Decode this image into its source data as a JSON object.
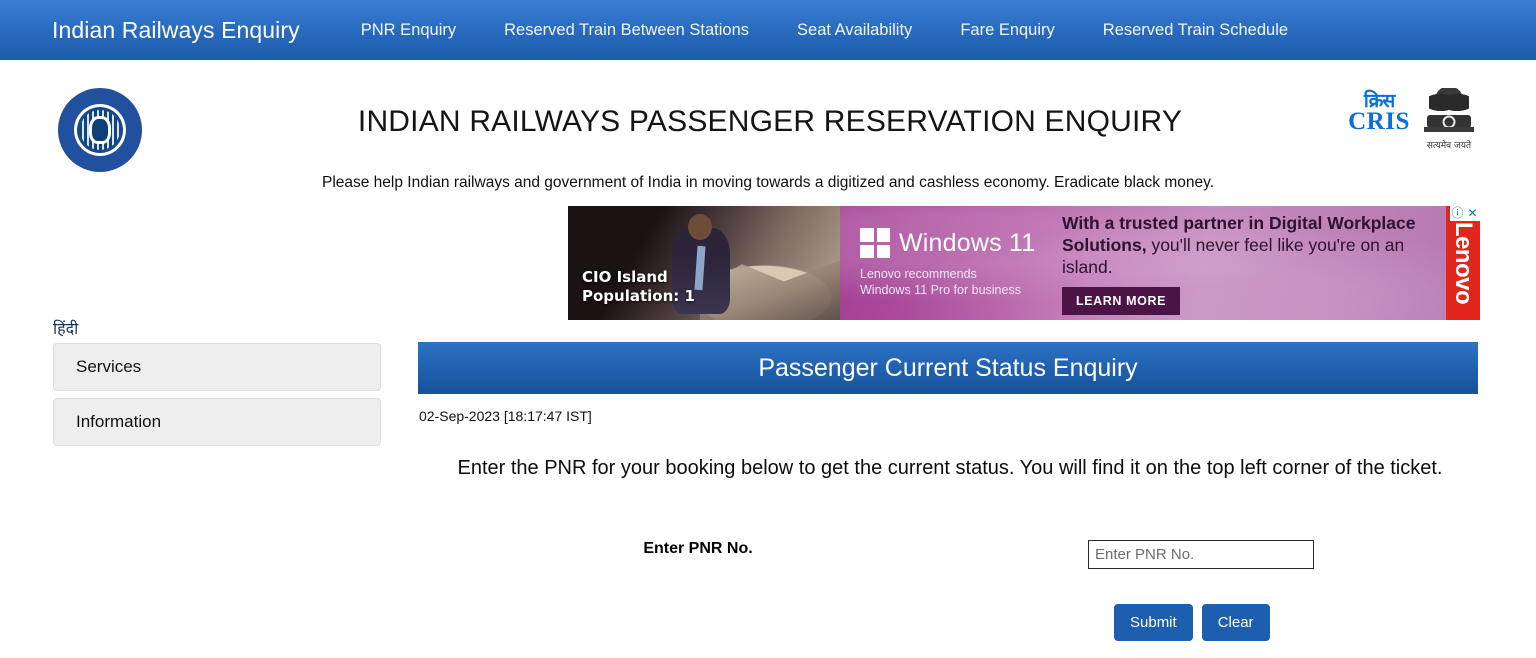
{
  "navbar": {
    "brand": "Indian Railways Enquiry",
    "links": [
      {
        "label": "PNR Enquiry"
      },
      {
        "label": "Reserved Train Between Stations"
      },
      {
        "label": "Seat Availability"
      },
      {
        "label": "Fare Enquiry"
      },
      {
        "label": "Reserved Train Schedule"
      }
    ],
    "accent_color": "#2a6cc0"
  },
  "header": {
    "logo_icon": "indian-railways-emblem-icon",
    "title": "INDIAN RAILWAYS PASSENGER RESERVATION ENQUIRY",
    "cris_hindi": "क्रिस",
    "cris_text": "CRIS",
    "ashoka_motto": "सत्यमेव जयते",
    "message": "Please help Indian railways and government of India in moving towards a digitized and cashless economy. Eradicate black money."
  },
  "advertisement": {
    "photo_caption_line1": "CIO Island",
    "photo_caption_line2": "Population: 1",
    "product_name": "Windows 11",
    "product_sub_line1": "Lenovo recommends",
    "product_sub_line2": "Windows 11 Pro for business",
    "headline_bold_1": "With a trusted partner in Digital Workplace Solutions,",
    "headline_rest": " you'll never feel like you're on an island.",
    "cta_label": "LEARN MORE",
    "brand": "Lenovo",
    "adchoices_icon": "info-circle-icon",
    "close_icon": "close-icon",
    "brand_color": "#e1261d"
  },
  "sidebar": {
    "language_link": "हिंदी",
    "panels": [
      {
        "label": "Services"
      },
      {
        "label": "Information"
      }
    ]
  },
  "main": {
    "section_title": "Passenger Current Status Enquiry",
    "timestamp": "02-Sep-2023 [18:17:47 IST]",
    "instructions": "Enter the PNR for your booking below to get the current status. You will find it on the top left corner of the ticket.",
    "form": {
      "pnr_label": "Enter PNR No.",
      "pnr_placeholder": "Enter PNR No.",
      "pnr_value": "",
      "submit_label": "Submit",
      "clear_label": "Clear"
    },
    "title_bar_color": "#1f5fad",
    "button_color": "#1d5fae"
  }
}
